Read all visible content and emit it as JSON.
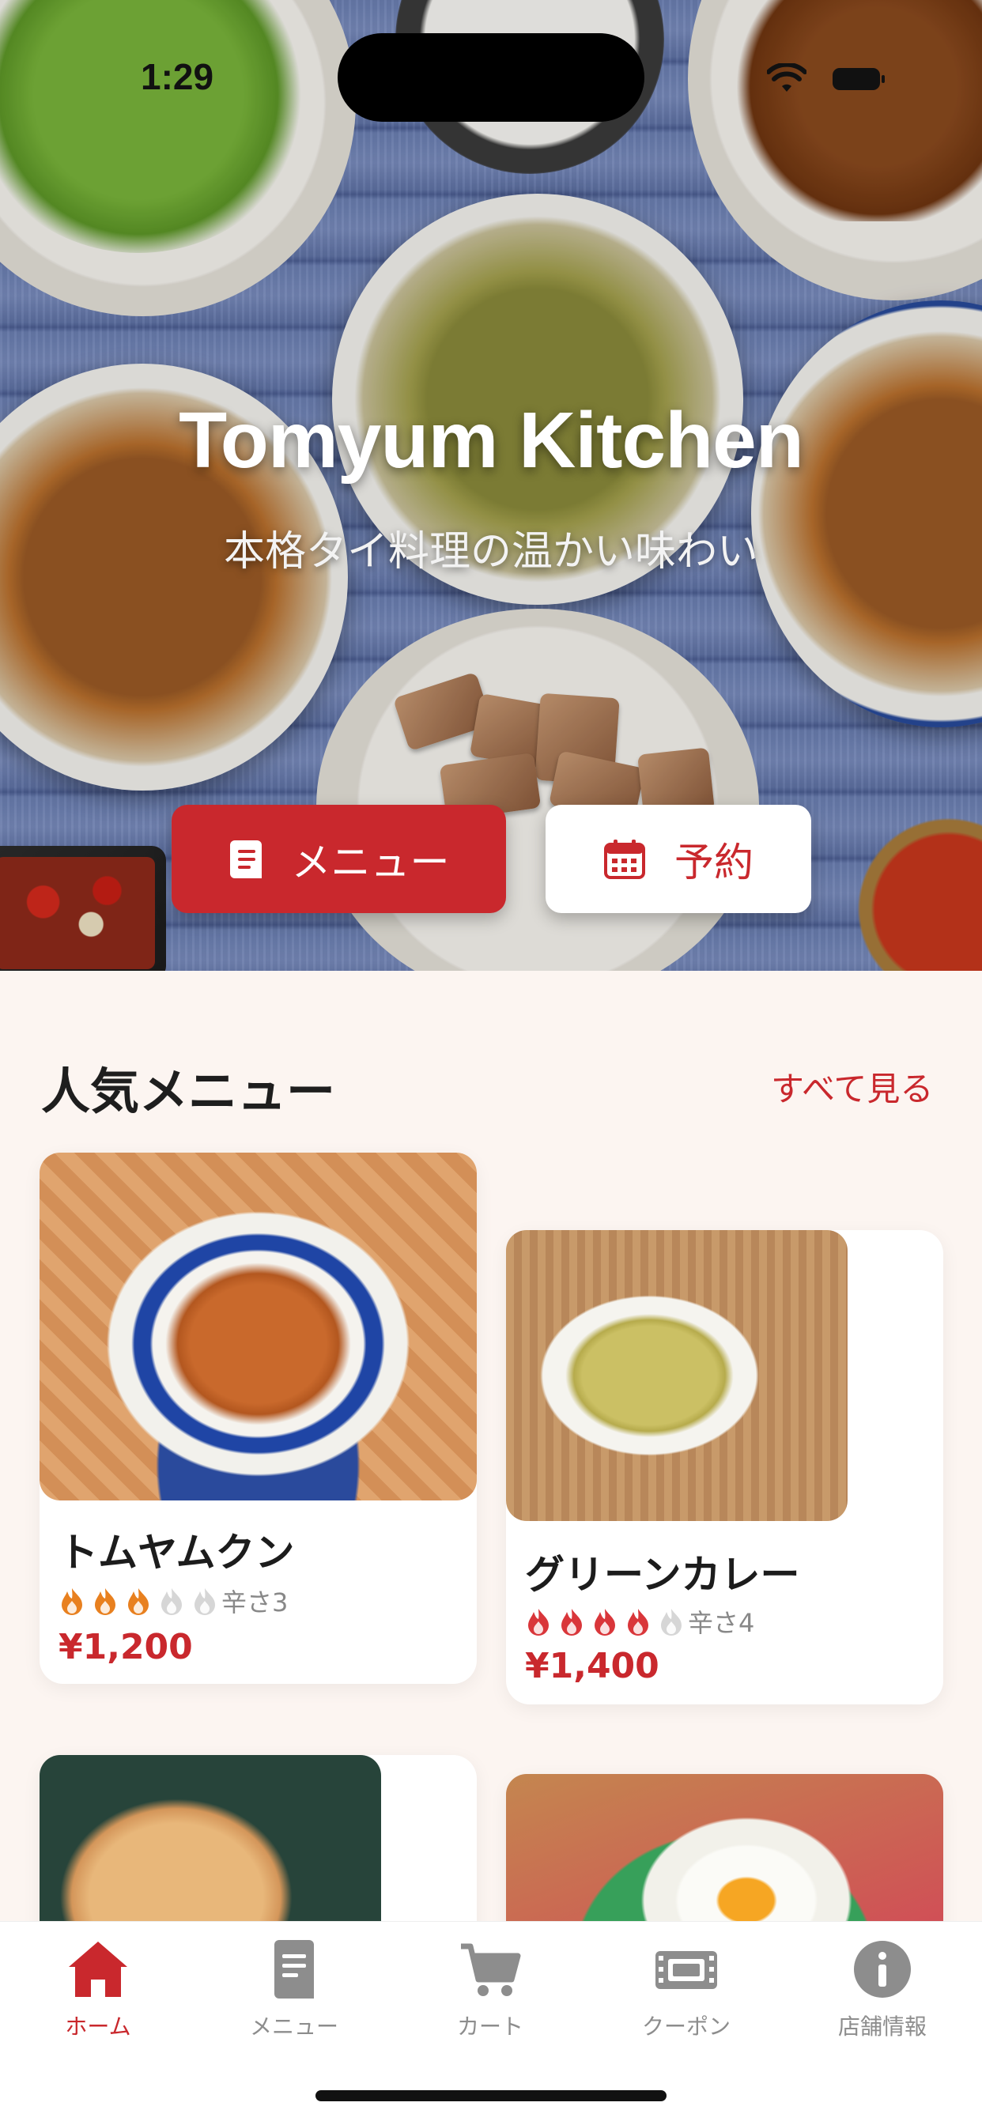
{
  "status_bar": {
    "time": "1:29"
  },
  "hero": {
    "title": "Tomyum Kitchen",
    "subtitle": "本格タイ料理の温かい味わい",
    "menu_button": "メニュー",
    "reserve_button": "予約"
  },
  "popular": {
    "title": "人気メニュー",
    "see_all": "すべて見る",
    "items": [
      {
        "name": "トムヤムクン",
        "spice_level": 3,
        "spice_max": 5,
        "spice_label": "辛さ3",
        "price": "¥1,200",
        "flame_color": "#e8801f"
      },
      {
        "name": "グリーンカレー",
        "spice_level": 4,
        "spice_max": 5,
        "spice_label": "辛さ4",
        "price": "¥1,400",
        "flame_color": "#d9363a"
      }
    ]
  },
  "tab_bar": {
    "items": [
      {
        "label": "ホーム",
        "icon": "home-icon",
        "active": true
      },
      {
        "label": "メニュー",
        "icon": "menu-book-icon",
        "active": false
      },
      {
        "label": "カート",
        "icon": "cart-icon",
        "active": false
      },
      {
        "label": "クーポン",
        "icon": "coupon-icon",
        "active": false
      },
      {
        "label": "店舗情報",
        "icon": "info-icon",
        "active": false
      }
    ]
  },
  "colors": {
    "accent": "#c9282d",
    "background": "#fcf5f1",
    "inactive": "#8d8d8d"
  }
}
